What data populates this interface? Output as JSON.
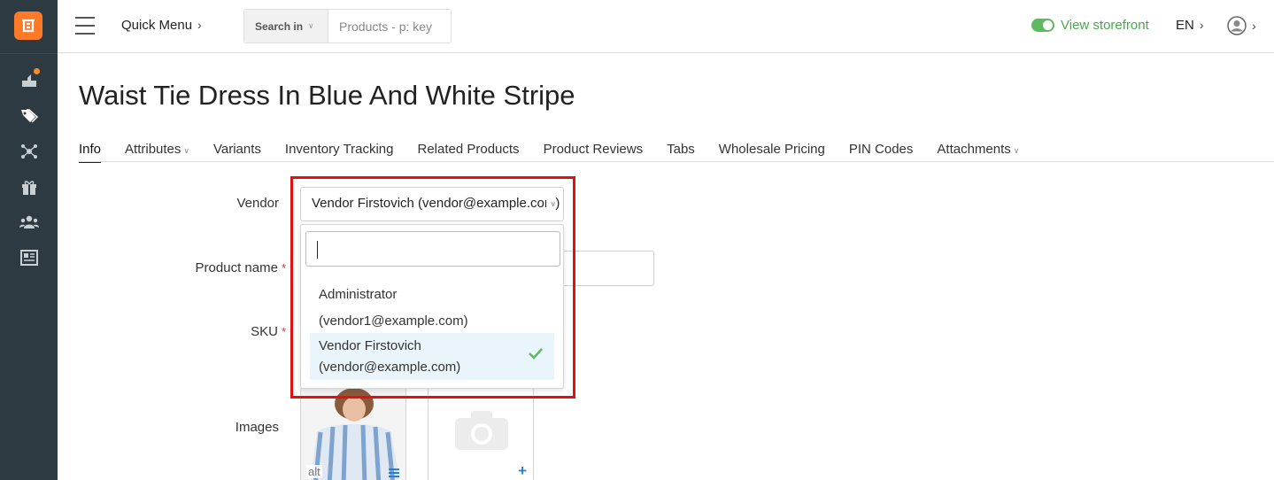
{
  "header": {
    "quick_menu": "Quick Menu",
    "search_in_label": "Search in",
    "search_placeholder": "Products - p: key",
    "view_storefront": "View storefront",
    "language": "EN"
  },
  "product": {
    "title": "Waist Tie Dress In Blue And White Stripe"
  },
  "tabs": [
    {
      "label": "Info"
    },
    {
      "label": "Attributes"
    },
    {
      "label": "Variants"
    },
    {
      "label": "Inventory Tracking"
    },
    {
      "label": "Related Products"
    },
    {
      "label": "Product Reviews"
    },
    {
      "label": "Tabs"
    },
    {
      "label": "Wholesale Pricing"
    },
    {
      "label": "PIN Codes"
    },
    {
      "label": "Attachments"
    }
  ],
  "form": {
    "vendor_label": "Vendor",
    "vendor_value": "Vendor Firstovich (vendor@example.com)",
    "product_name_label": "Product name",
    "sku_label": "SKU",
    "images_label": "Images",
    "required_mark": "*",
    "alt_label": "alt"
  },
  "vendor_dropdown": {
    "search_value": "",
    "options": [
      {
        "line1": "Administrator",
        "line2": "(vendor1@example.com)"
      },
      {
        "line1": "Vendor Firstovich",
        "line2": "(vendor@example.com)"
      }
    ],
    "selected_index": 1
  },
  "colors": {
    "sidebar": "#2e3a41",
    "logo": "#ff7a28",
    "storefront_green": "#4aa84c",
    "highlight_red": "#e21010",
    "selected_row": "#eaf4fb"
  }
}
